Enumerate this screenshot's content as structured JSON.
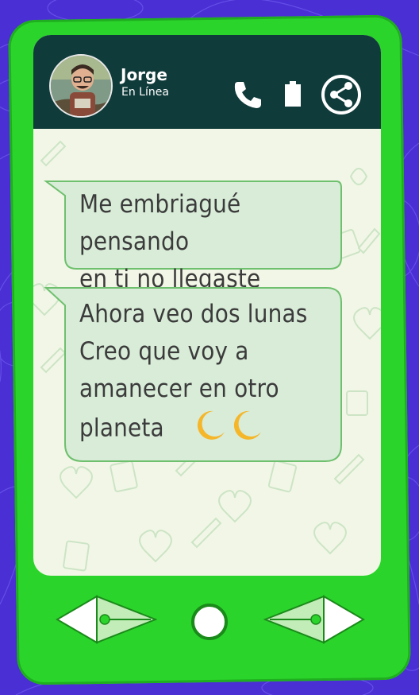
{
  "contact": {
    "name": "Jorge",
    "status": "En Línea"
  },
  "header_icons": [
    "phone-icon",
    "battery-icon",
    "share-icon"
  ],
  "messages": [
    {
      "lines": [
        "Me embriagué pensando",
        "en ti no llegaste"
      ]
    },
    {
      "lines": [
        "Ahora veo dos lunas",
        "Creo que voy a",
        "amanecer en otro",
        "planeta"
      ],
      "emoji": "🌙🌙"
    }
  ],
  "nav": [
    "back-arrow",
    "home-circle",
    "forward-arrow"
  ],
  "colors": {
    "background": "#4a2fd4",
    "phone_body": "#2bd42b",
    "header": "#0f3b3a",
    "bubble_fill": "#d8ecd8",
    "bubble_stroke": "#6ec06e",
    "moon": "#f5b62a"
  }
}
